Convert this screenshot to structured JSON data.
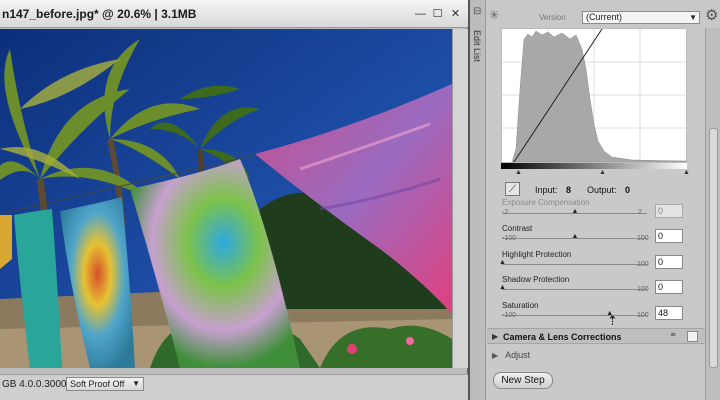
{
  "image_window": {
    "title": "n147_before.jpg* @ 20.6% | 3.1MB",
    "buttons": {
      "minimize": "—",
      "maximize": "☐",
      "close": "✕"
    },
    "status_profile": "GB 4.0.0.3000",
    "soft_proof": "Soft Proof Off"
  },
  "panel": {
    "edit_list_tab": "Edit List",
    "version_label": "Version",
    "version_value": "(Current)",
    "curve": {
      "input_label": "Input:",
      "input_value": "8",
      "output_label": "Output:",
      "output_value": "0"
    },
    "sliders": [
      {
        "label": "Exposure Compensation",
        "min": "-2",
        "max": "2",
        "value": "0",
        "position": 0.5,
        "disabled": true
      },
      {
        "label": "Contrast",
        "min": "-100",
        "max": "100",
        "value": "0",
        "position": 0.5,
        "disabled": false
      },
      {
        "label": "Highlight Protection",
        "min": "",
        "max": "100",
        "value": "0",
        "position": 0.0,
        "disabled": false
      },
      {
        "label": "Shadow Protection",
        "min": "",
        "max": "100",
        "value": "0",
        "position": 0.0,
        "disabled": false
      },
      {
        "label": "Saturation",
        "min": "-100",
        "max": "100",
        "value": "48",
        "position": 0.74,
        "disabled": false
      }
    ],
    "section_camera": "Camera & Lens Corrections",
    "section_adjust": "Adjust",
    "new_step": "New Step"
  },
  "colors": {
    "sky": "#1e4fa8",
    "selection_border": "#d9c34a"
  }
}
